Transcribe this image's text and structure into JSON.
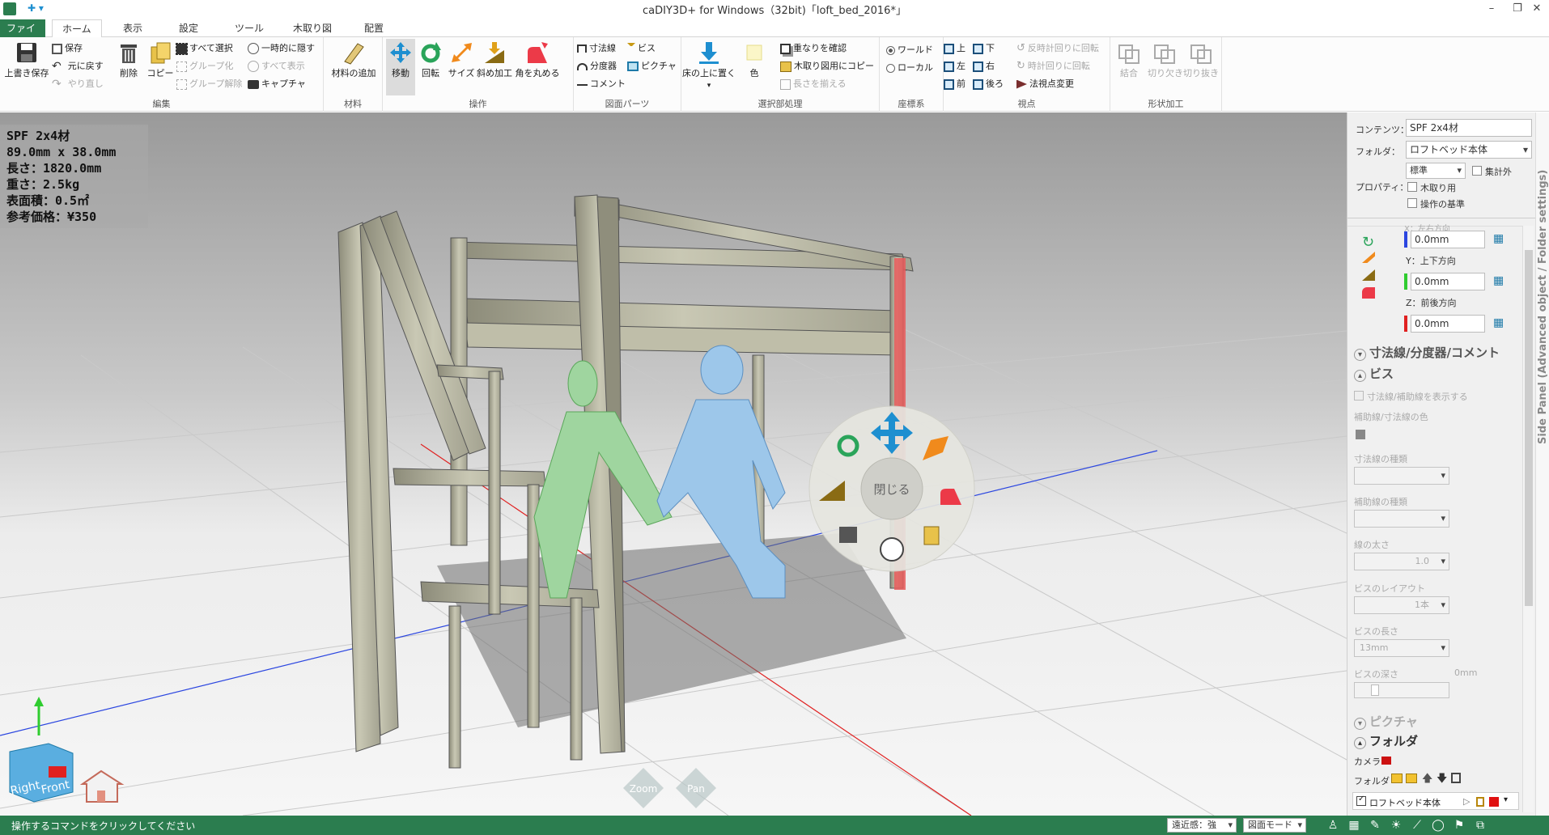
{
  "window": {
    "title": "caDIY3D+ for Windows（32bit)「loft_bed_2016*」",
    "minimize": "–",
    "maximize": "❐",
    "close": "✕",
    "quick_access": "✚ ▾"
  },
  "tabs": [
    "ファイル",
    "ホーム",
    "表示",
    "設定",
    "ツール",
    "木取り図",
    "配置"
  ],
  "ribbon": {
    "edit": {
      "label": "編集",
      "overwrite_save": "上書き保存",
      "save": "保存",
      "undo": "元に戻す",
      "redo": "やり直し",
      "delete": "削除",
      "copy": "コピー",
      "select_all": "すべて選択",
      "group": "グループ化",
      "ungroup": "グループ解除",
      "hide_temp": "一時的に隠す",
      "show_all": "すべて表示",
      "capture": "キャプチャ"
    },
    "material": {
      "label": "材料",
      "add": "材料の追加"
    },
    "operation": {
      "label": "操作",
      "move": "移動",
      "rotate": "回転",
      "size": "サイズ",
      "bevel": "斜め加工",
      "round": "角を丸める"
    },
    "drawing_parts": {
      "label": "図面パーツ",
      "dimension": "寸法線",
      "protractor": "分度器",
      "comment": "コメント",
      "screw": "ビス",
      "picture": "ピクチャ"
    },
    "selection": {
      "label": "選択部処理",
      "on_floor": "床の上に置く",
      "color": "色",
      "check_overlap": "重なりを確認",
      "copy_cut": "木取り図用にコピー",
      "align_length": "長さを揃える"
    },
    "coords": {
      "label": "座標系",
      "world": "ワールド",
      "local": "ローカル"
    },
    "view": {
      "label": "視点",
      "top": "上",
      "bottom": "下",
      "left": "左",
      "right": "右",
      "front": "前",
      "back": "後ろ",
      "ccw": "反時計回りに回転",
      "cw": "時計回りに回転",
      "normal": "法視点変更"
    },
    "shape": {
      "label": "形状加工",
      "join": "結合",
      "notch": "切り欠き",
      "cutout": "切り抜き"
    }
  },
  "info": {
    "name": "SPF 2x4材",
    "dims": "89.0mm x 38.0mm",
    "length": "長さ：1820.0mm",
    "weight": "重さ：2.5kg",
    "surface": "表面積：0.5㎡",
    "price": "参考価格：¥350"
  },
  "radial_menu": {
    "close": "閉じる"
  },
  "nav": {
    "right": "Right",
    "front": "Front",
    "zoom": "Zoom",
    "pan": "Pan"
  },
  "side_panel": {
    "vertical_title": "Side Panel (Advanced object / Folder settings)",
    "content_label": "コンテンツ：",
    "content_value": "SPF 2x4材",
    "folder_label": "フォルダ：",
    "folder_value": "ロフトベッド本体",
    "property_label": "プロパティ：",
    "property_value": "標準",
    "aggregate_off": "集計外",
    "for_cut": "木取り用",
    "op_base": "操作の基準",
    "x_label": "X：左右方向",
    "x_value": "0.0mm",
    "y_label": "Y：上下方向",
    "y_value": "0.0mm",
    "z_label": "Z：前後方向",
    "z_value": "0.0mm",
    "sec_dim": "寸法線/分度器/コメント",
    "sec_screw": "ビス",
    "show_dim": "寸法線/補助線を表示する",
    "aux_color": "補助線/寸法線の色",
    "dim_type": "寸法線の種類",
    "aux_type": "補助線の種類",
    "line_width": "線の太さ",
    "line_width_value": "1.0",
    "screw_layout": "ビスのレイアウト",
    "screw_layout_value": "1本",
    "screw_length": "ビスの長さ",
    "screw_length_value": "13mm",
    "screw_depth": "ビスの深さ",
    "screw_depth_value": "0mm",
    "sec_picture": "ピクチャ",
    "sec_folder": "フォルダ",
    "camera": "カメラ",
    "folder": "フォルダ",
    "folder_item": "ロフトベッド本体"
  },
  "status": {
    "message": "操作するコマンドをクリックしてください",
    "perspective": "遠近感：強",
    "mode": "図面モード"
  },
  "colors": {
    "brand": "#2b7d4f",
    "accent_blue": "#1e8fd0",
    "accent_orange": "#f08a1c",
    "x_axis": "#2b46e0",
    "y_axis": "#2fcc2f",
    "z_axis": "#e02020"
  }
}
